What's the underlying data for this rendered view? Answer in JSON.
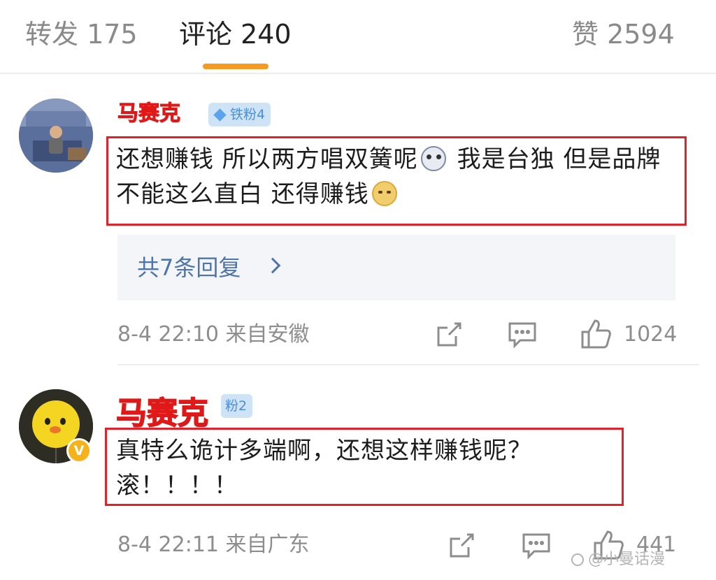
{
  "tabs": {
    "repost": "转发 175",
    "comments": "评论 240",
    "likes": "赞 2594",
    "active": "comments"
  },
  "comments": [
    {
      "username": "马赛克",
      "fan_badge": "铁粉4",
      "text_part1": "还想赚钱 所以两方唱双簧呢",
      "emoji1": "husky-emoji",
      "text_part2": " 我是台独 但是品牌不能这么直白 还得赚钱",
      "emoji2": "doge-emoji",
      "replies_label": "共7条回复",
      "meta": "8-4 22:10 来自安徽",
      "like_count": "1024"
    },
    {
      "username": "马赛克",
      "fan_badge": "粉2",
      "text": "真特么诡计多端啊，还想这样赚钱呢？滚！！！！",
      "meta": "8-4 22:11 来自广东",
      "like_count": "441",
      "verified": true
    }
  ],
  "colors": {
    "accent": "#f59b22",
    "highlight_red": "#e0222a",
    "link_blue": "#4d75a8",
    "badge_bg": "#cfe3f7"
  },
  "watermark": "@小曼话漫"
}
